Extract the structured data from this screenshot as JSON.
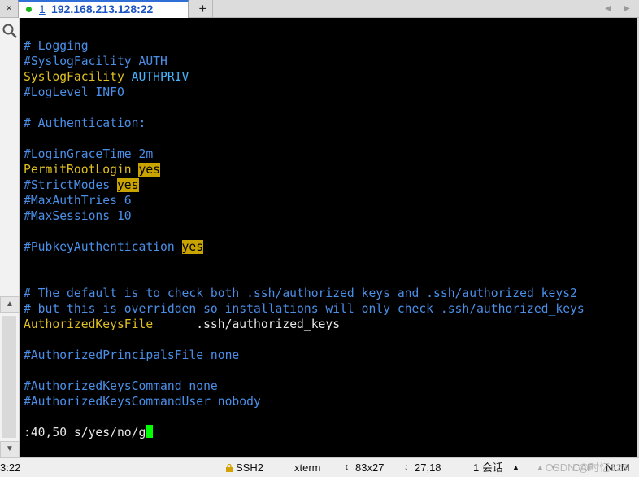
{
  "tabbar": {
    "close_glyph": "×",
    "active_tab": {
      "number": "1",
      "title": "192.168.213.128:22"
    },
    "add_glyph": "+",
    "nav_left_glyph": "◀",
    "nav_right_glyph": "▶"
  },
  "terminal": {
    "lines": [
      {
        "text": "# Logging",
        "color": "blue"
      },
      {
        "text": "#SyslogFacility AUTH",
        "color": "blue"
      },
      {
        "parts": [
          {
            "text": "SyslogFacility ",
            "color": "yellow"
          },
          {
            "text": "AUTHPRIV",
            "color": "cyan"
          }
        ]
      },
      {
        "text": "#LogLevel INFO",
        "color": "blue"
      },
      {
        "text": ""
      },
      {
        "text": "# Authentication:",
        "color": "blue"
      },
      {
        "text": ""
      },
      {
        "text": "#LoginGraceTime 2m",
        "color": "blue"
      },
      {
        "parts": [
          {
            "text": "PermitRootLogin ",
            "color": "yellow"
          },
          {
            "text": "yes",
            "highlight": true
          }
        ]
      },
      {
        "parts": [
          {
            "text": "#StrictModes ",
            "color": "blue"
          },
          {
            "text": "yes",
            "highlight": true
          }
        ]
      },
      {
        "text": "#MaxAuthTries 6",
        "color": "blue"
      },
      {
        "text": "#MaxSessions 10",
        "color": "blue"
      },
      {
        "text": ""
      },
      {
        "parts": [
          {
            "text": "#PubkeyAuthentication ",
            "color": "blue"
          },
          {
            "text": "yes",
            "highlight": true
          }
        ]
      },
      {
        "text": ""
      },
      {
        "text": ""
      },
      {
        "text": "# The default is to check both .ssh/authorized_keys and .ssh/authorized_keys2",
        "color": "blue"
      },
      {
        "text": "# but this is overridden so installations will only check .ssh/authorized_keys",
        "color": "blue"
      },
      {
        "parts": [
          {
            "text": "AuthorizedKeysFile      ",
            "color": "yellow"
          },
          {
            "text": ".ssh/authorized_keys",
            "color": "white"
          }
        ]
      },
      {
        "text": ""
      },
      {
        "text": "#AuthorizedPrincipalsFile none",
        "color": "blue"
      },
      {
        "text": ""
      },
      {
        "text": "#AuthorizedKeysCommand none",
        "color": "blue"
      },
      {
        "text": "#AuthorizedKeysCommandUser nobody",
        "color": "blue"
      },
      {
        "text": ""
      },
      {
        "parts": [
          {
            "text": ":40,50 s/yes/no/g",
            "color": "white"
          }
        ],
        "cursor": true
      }
    ]
  },
  "statusbar": {
    "clock_fragment": "3:22",
    "protocol": "SSH2",
    "terminal_type": "xterm",
    "size": "83x27",
    "cursor_position": "27,18",
    "sessions": "1 会话",
    "caps": "CAP",
    "num": "NUM"
  },
  "watermark": "CSDN @时忆523",
  "colors": {
    "blue": "#4a8fe8",
    "yellow": "#e0c020",
    "white": "#e8e8e8",
    "cyan": "#46b4ff",
    "highlight_bg": "#c9a400",
    "cursor": "#00ff00",
    "terminal_bg": "#000000"
  }
}
